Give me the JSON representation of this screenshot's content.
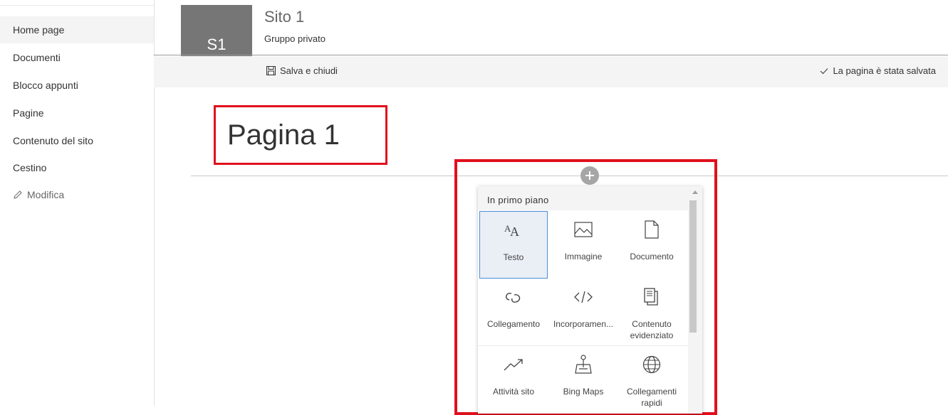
{
  "nav": {
    "items": [
      {
        "label": "Home page",
        "selected": true
      },
      {
        "label": "Documenti"
      },
      {
        "label": "Blocco appunti"
      },
      {
        "label": "Pagine"
      },
      {
        "label": "Contenuto del sito"
      },
      {
        "label": "Cestino"
      }
    ],
    "edit_label": "Modifica"
  },
  "site": {
    "logo_text": "S1",
    "title": "Sito 1",
    "subtitle": "Gruppo privato"
  },
  "command_bar": {
    "save_close_label": "Salva e chiudi",
    "status_label": "La pagina è stata salvata"
  },
  "page": {
    "title": "Pagina 1"
  },
  "toolbox": {
    "heading": "In primo piano",
    "items": [
      {
        "label": "Testo",
        "icon": "text-icon",
        "selected": true
      },
      {
        "label": "Immagine",
        "icon": "image-icon"
      },
      {
        "label": "Documento",
        "icon": "document-icon"
      },
      {
        "label": "Collegamento",
        "icon": "link-icon"
      },
      {
        "label": "Incorporamen...",
        "icon": "embed-icon"
      },
      {
        "label_line1": "Contenuto",
        "label_line2": "evidenziato",
        "icon": "highlighted-content-icon"
      },
      {
        "label": "Attività sito",
        "icon": "site-activity-icon"
      },
      {
        "label": "Bing Maps",
        "icon": "bing-maps-icon"
      },
      {
        "label_line1": "Collegamenti",
        "label_line2": "rapidi",
        "icon": "globe-icon"
      }
    ]
  },
  "colors": {
    "highlight_red": "#e0101d",
    "logo_gray": "#767676",
    "selection_blue": "#4a8fd9"
  }
}
